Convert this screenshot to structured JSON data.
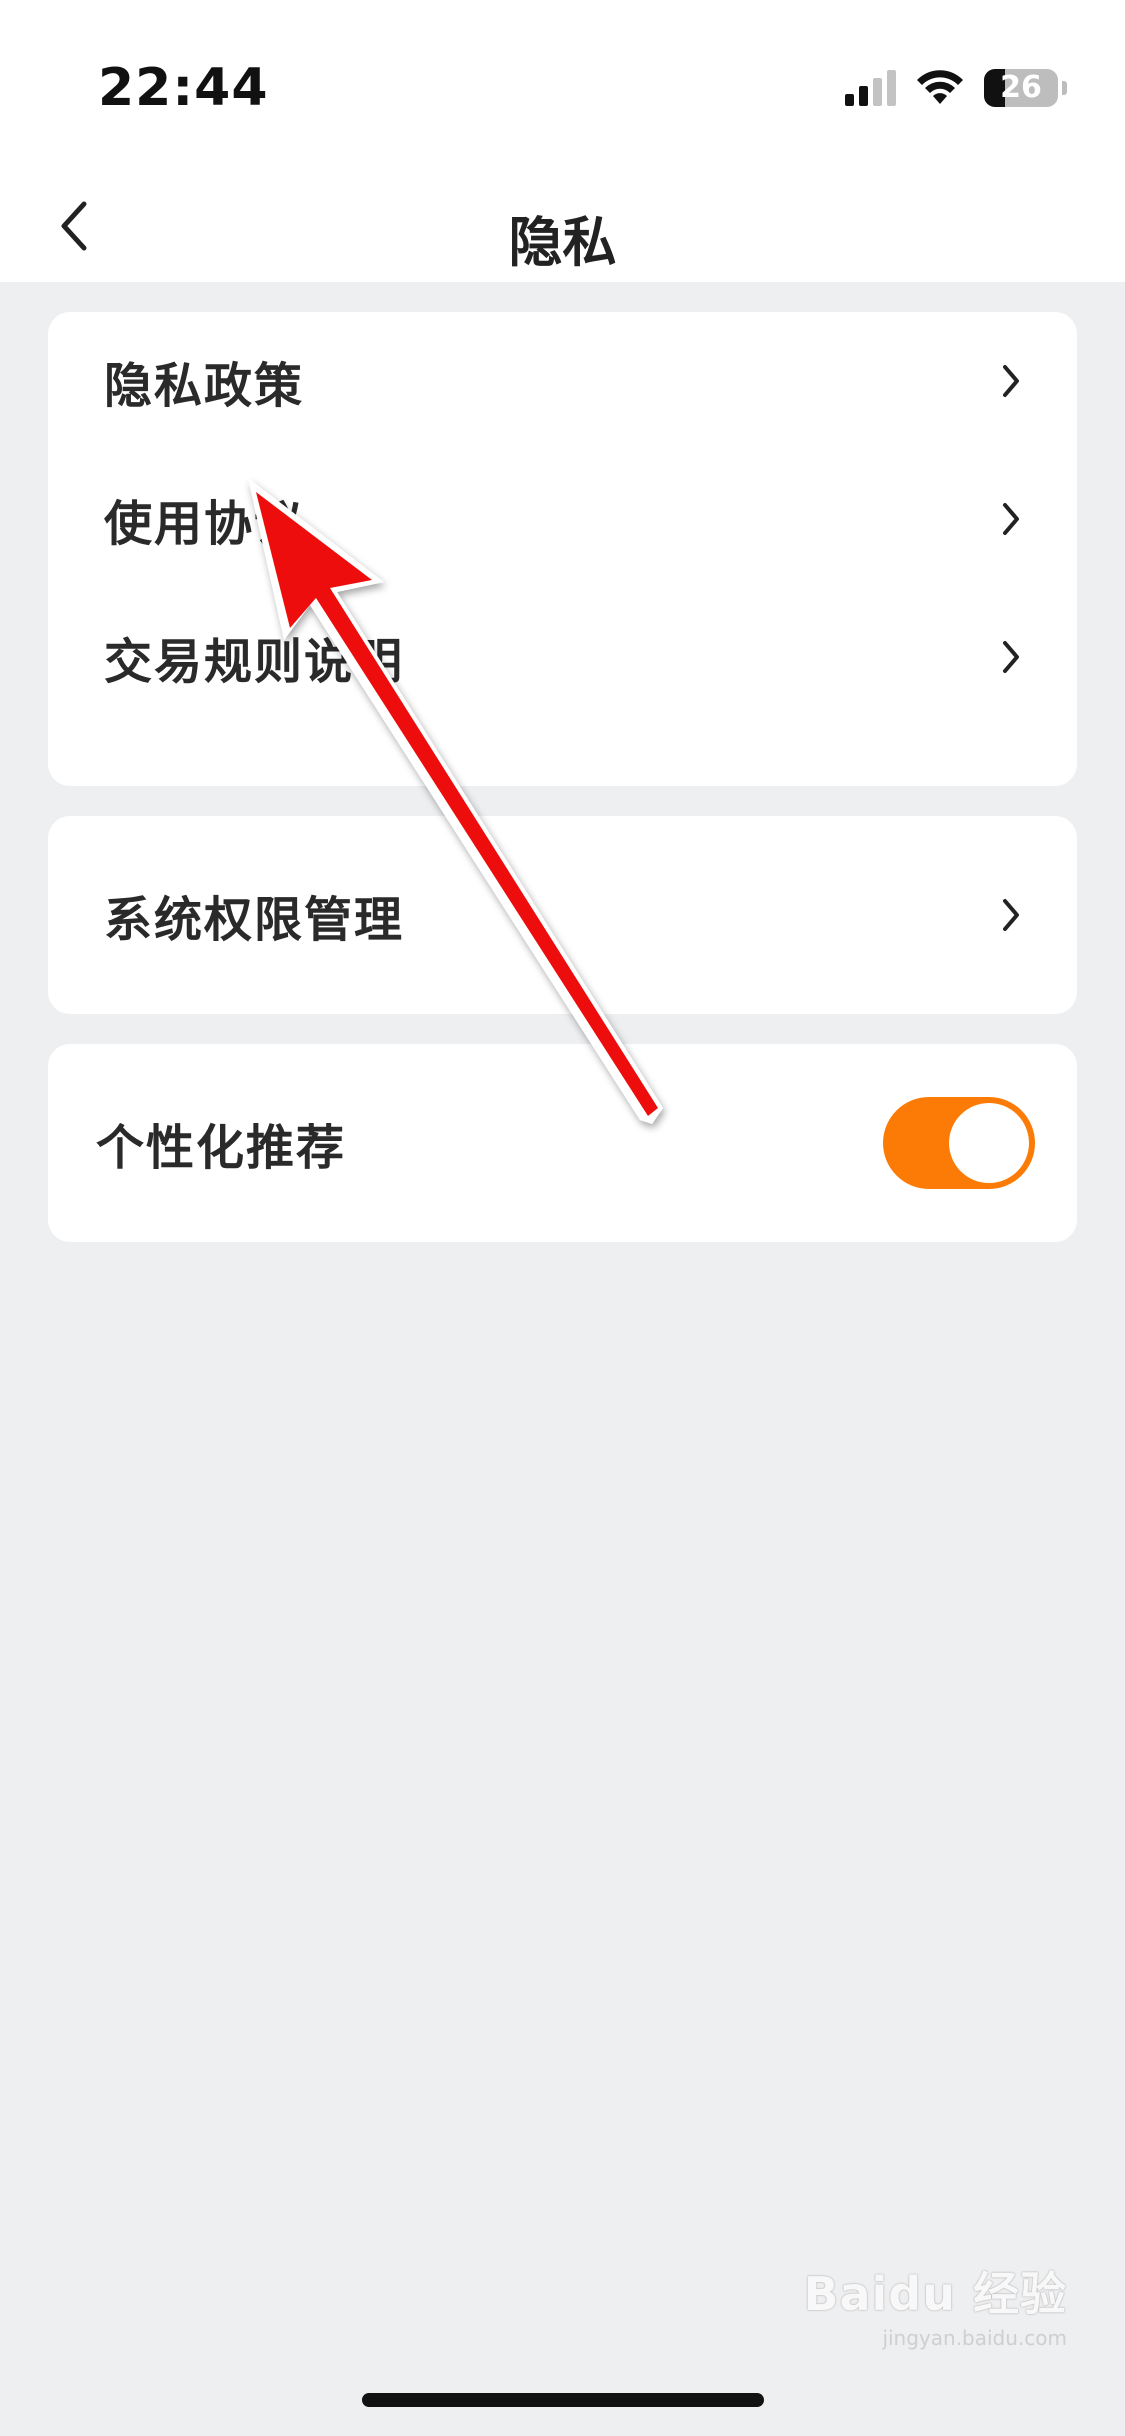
{
  "status_bar": {
    "time": "22:44",
    "battery_level": "26",
    "icons": [
      "cellular-signal-icon",
      "wifi-icon",
      "battery-icon"
    ]
  },
  "nav": {
    "title": "隐私",
    "back_icon": "chevron-left-icon"
  },
  "sections": [
    {
      "items": [
        {
          "label": "隐私政策",
          "icon": "chevron-right-icon"
        },
        {
          "label": "使用协议",
          "icon": "chevron-right-icon"
        },
        {
          "label": "交易规则说明",
          "icon": "chevron-right-icon"
        }
      ]
    },
    {
      "items": [
        {
          "label": "系统权限管理",
          "icon": "chevron-right-icon"
        }
      ]
    },
    {
      "items": [
        {
          "label": "个性化推荐",
          "toggle_on": true
        }
      ]
    }
  ],
  "annotation": {
    "type": "arrow",
    "color": "#ee1111",
    "points_to": "隐私政策"
  },
  "watermark": {
    "main": "Baidu 经验",
    "sub": "jingyan.baidu.com"
  },
  "colors": {
    "accent": "#fb7b06",
    "background": "#eeeff1",
    "card": "#ffffff"
  }
}
